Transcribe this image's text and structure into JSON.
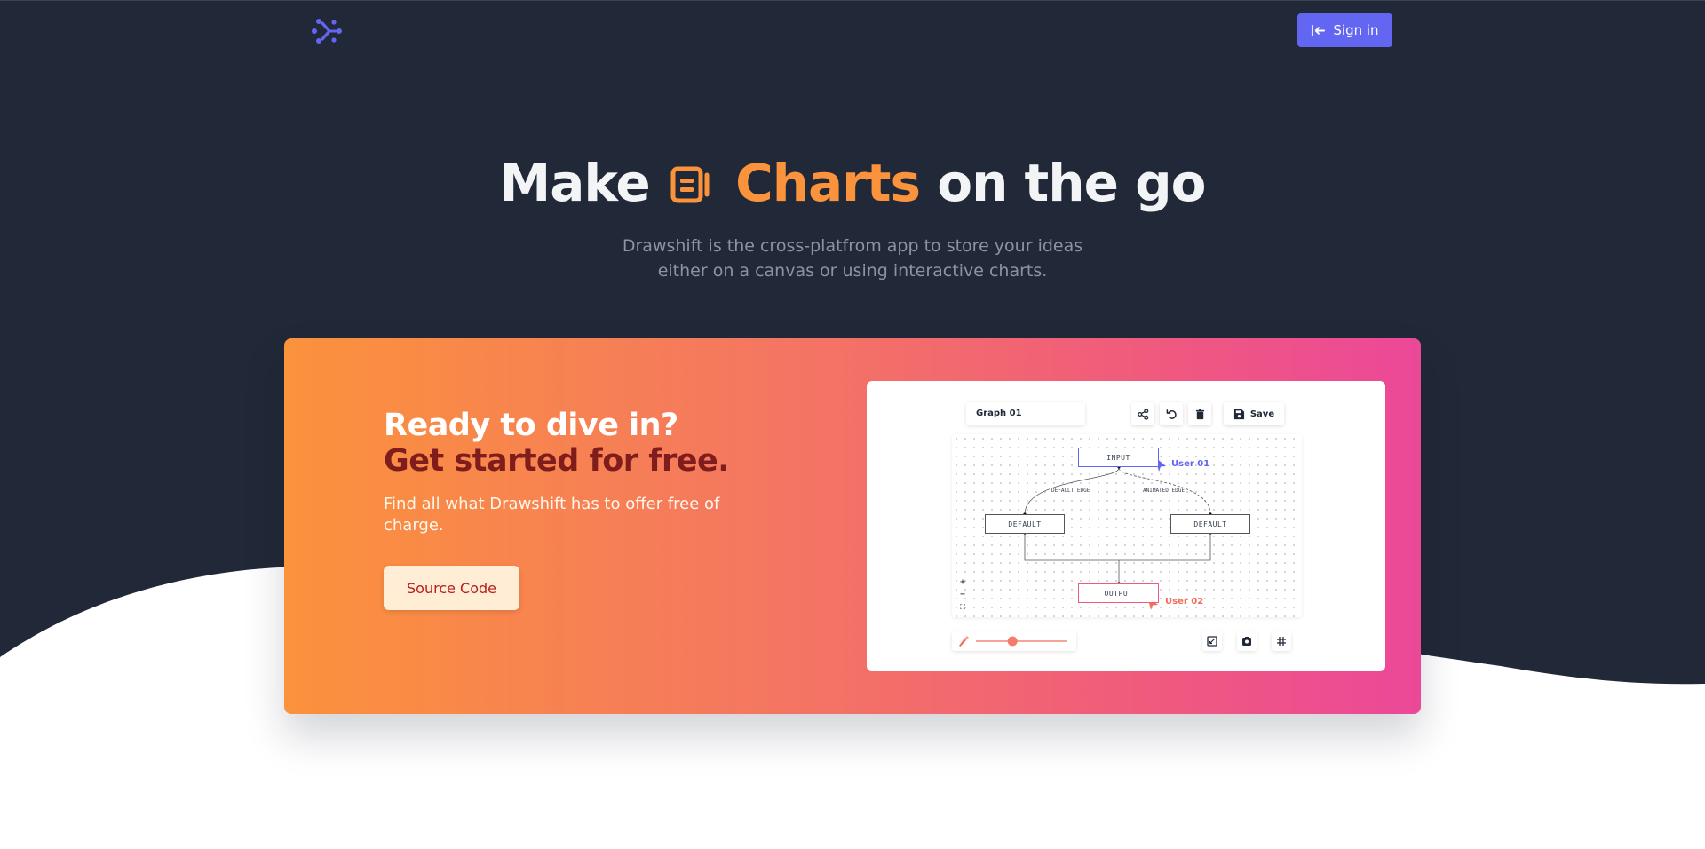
{
  "header": {
    "logo_icon": "drawshift-logo-icon",
    "signin_label": "Sign in",
    "signin_icon": "sign-in-icon"
  },
  "hero": {
    "title_prefix": "Make",
    "title_icon": "charts-icon",
    "title_accent": "Charts",
    "title_suffix": "on the go",
    "subtitle_line1": "Drawshift is the cross-platfrom app to store your ideas",
    "subtitle_line2": "either on a canvas or using interactive charts."
  },
  "cta": {
    "heading_line1": "Ready to dive in?",
    "heading_line2": "Get started for free.",
    "description": "Find all what Drawshift has to offer free of charge.",
    "button_label": "Source Code"
  },
  "preview": {
    "graph_name": "Graph 01",
    "toolbar_icons": [
      "share-icon",
      "undo-icon",
      "trash-icon"
    ],
    "save_label": "Save",
    "save_icon": "save-icon",
    "nodes": {
      "input": "INPUT",
      "default_left": "DEFAULT",
      "default_right": "DEFAULT",
      "output": "OUTPUT"
    },
    "edge_labels": {
      "left": "DEFAULT EDGE",
      "right": "ANIMATED EDGE"
    },
    "users": {
      "user1": "User 01",
      "user2": "User 02"
    },
    "zoom_controls": [
      "+",
      "−",
      "⛶"
    ],
    "bottom_icons": [
      "brush-icon",
      "fit-view-icon",
      "screenshot-icon",
      "grid-icon"
    ],
    "brush_size": 0.4
  },
  "colors": {
    "background_dark": "#212837",
    "brand": "#6366f1",
    "accent_orange": "#fb923c",
    "cta_gradient_start": "#fb923c",
    "cta_gradient_end": "#ec4899",
    "user1": "#6366f1",
    "user2": "#f26d5b"
  }
}
